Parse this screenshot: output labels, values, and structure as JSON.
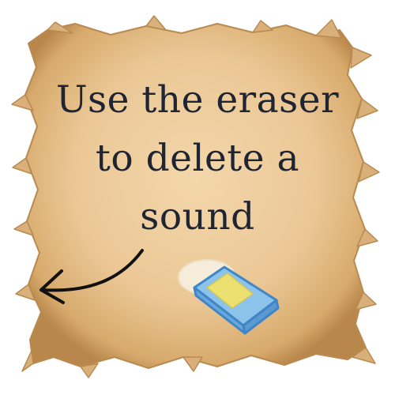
{
  "tutorial": {
    "line1": "Use the eraser",
    "line2": "to delete a",
    "line3": "sound"
  },
  "icons": {
    "arrow": "curved-arrow-left-icon",
    "eraser": "eraser-icon"
  },
  "colors": {
    "parchment": "#ecc995",
    "parchment_edge": "#c89a5c",
    "text": "#1f2433",
    "eraser_body": "#8cc3ea",
    "eraser_outline": "#3f86c8",
    "eraser_stripe": "#f2e36a",
    "eraser_tip": "#f8f0e2"
  }
}
